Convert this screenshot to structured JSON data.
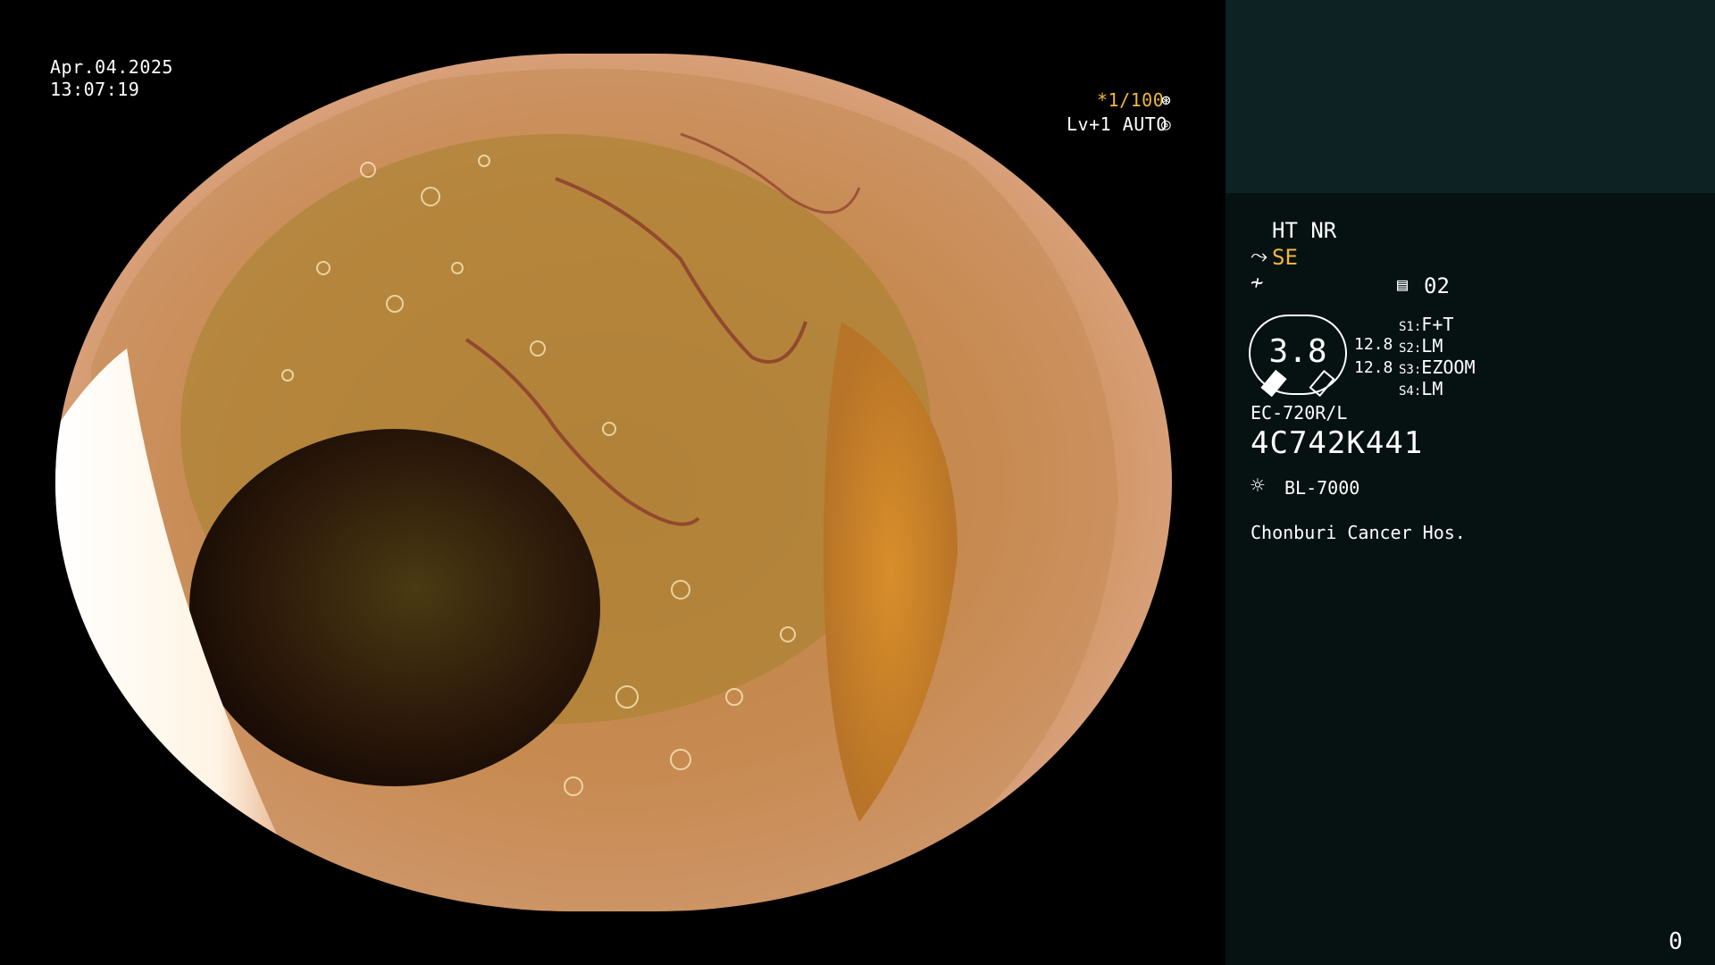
{
  "screen": {
    "date": "Apr.04.2025",
    "time": "13:07:19",
    "shutter": "*1/100",
    "shutter_icon": "aperture-icon",
    "level": "Lv+1 AUTO",
    "level_icon": "iris-icon",
    "page_number": "0"
  },
  "panel": {
    "mode": "HT NR",
    "se_label": "SE",
    "se_icon": "scope-tip-icon",
    "freeze_icon": "freeze-icon",
    "memory_icon": "memory-icon",
    "memory_value": "02",
    "gauge_value": "3.8",
    "gauge_left": "12.8",
    "gauge_right": "12.8",
    "switches": [
      {
        "key": "S1:",
        "value": "F+T"
      },
      {
        "key": "S2:",
        "value": "LM"
      },
      {
        "key": "S3:",
        "value": "EZOOM"
      },
      {
        "key": "S4:",
        "value": "LM"
      }
    ],
    "scope_model": "EC-720R/L",
    "serial": "4C742K441",
    "light_icon": "light-source-icon",
    "light_source": "BL-7000",
    "hospital": "Chonburi Cancer Hos."
  },
  "colors": {
    "panel_bg": "#061111",
    "panel_top_bg": "#0d2223",
    "accent": "#f0b838"
  }
}
